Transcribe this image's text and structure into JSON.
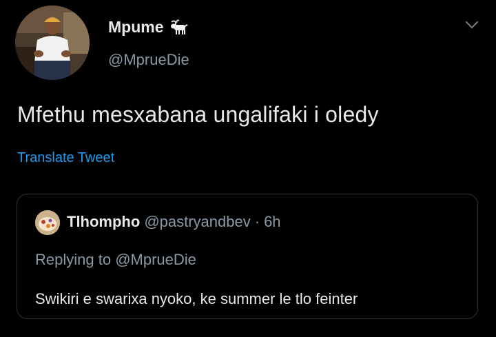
{
  "author": {
    "display_name": "Mpume",
    "name_emoji": "goat-icon",
    "handle": "@MprueDie"
  },
  "tweet": {
    "text": "Mfethu mesxabana ungalifaki i oledy",
    "translate_label": "Translate Tweet"
  },
  "quoted_tweet": {
    "display_name": "Tlhompho",
    "handle": "@pastryandbev",
    "separator": "·",
    "time": "6h",
    "replying_prefix": "Replying to",
    "replying_handle": "@MprueDie",
    "text": "Swikiri e swarixa nyoko, ke summer le tlo feinter"
  },
  "colors": {
    "background": "#000000",
    "text_primary": "#e7e9ea",
    "text_secondary": "#8b98a5",
    "link": "#1d9bf0",
    "border": "#2f3336"
  },
  "icons": {
    "more_menu": "chevron-down-icon"
  }
}
